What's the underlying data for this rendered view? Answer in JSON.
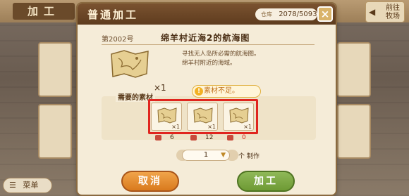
{
  "top": {
    "title": "加工",
    "back_label": "前往牧场"
  },
  "menu": {
    "label": "菜单"
  },
  "modal": {
    "title": "普通加工",
    "storage_label": "仓库",
    "storage_value": "2078/5093",
    "close_icon": "×"
  },
  "recipe": {
    "code": "第2002号",
    "name": "绵羊村近海2的航海图",
    "desc_line1": "寻找无人岛所必需的航海图。",
    "desc_line2": "绵羊村附近的海域。",
    "quantity": "×1"
  },
  "materials": {
    "label": "需要的素材",
    "warning": "素材不足。",
    "items": [
      {
        "multiplier": "×1",
        "owned": "6",
        "insufficient": false
      },
      {
        "multiplier": "×1",
        "owned": "12",
        "insufficient": false
      },
      {
        "multiplier": "×1",
        "owned": "0",
        "insufficient": true
      }
    ]
  },
  "make": {
    "count": "1",
    "unit_label": "个 制作"
  },
  "buttons": {
    "cancel": "取消",
    "make": "加工"
  },
  "colors": {
    "highlight": "#e0251e",
    "cancel": "#e8902e",
    "make": "#7ea844",
    "warning": "#c0701a"
  }
}
